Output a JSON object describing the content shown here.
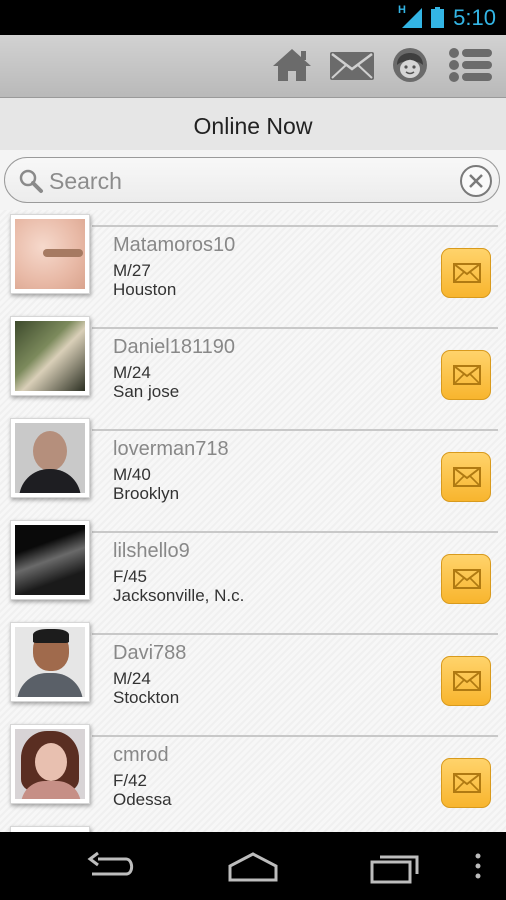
{
  "status_bar": {
    "time": "5:10",
    "network_type": "H",
    "accent_color": "#33b5e5"
  },
  "action_bar": {
    "icons": [
      "home-icon",
      "mail-icon",
      "profile-icon",
      "menu-list-icon"
    ]
  },
  "title": "Online Now",
  "search": {
    "placeholder": "Search"
  },
  "users": [
    {
      "name": "Matamoros10",
      "gender_age": "M/27",
      "location": "Houston"
    },
    {
      "name": "Daniel181190",
      "gender_age": "M/24",
      "location": "San jose"
    },
    {
      "name": "loverman718",
      "gender_age": "M/40",
      "location": "Brooklyn"
    },
    {
      "name": "lilshello9",
      "gender_age": "F/45",
      "location": "Jacksonville, N.c."
    },
    {
      "name": "Davi788",
      "gender_age": "M/24",
      "location": "Stockton"
    },
    {
      "name": "cmrod",
      "gender_age": "F/42",
      "location": "Odessa"
    }
  ],
  "colors": {
    "message_button": "#f8b52e",
    "message_button_border": "#d89a1d"
  },
  "nav_bar": {
    "icons": [
      "back-icon",
      "home-nav-icon",
      "recent-apps-icon",
      "overflow-menu-icon"
    ]
  }
}
